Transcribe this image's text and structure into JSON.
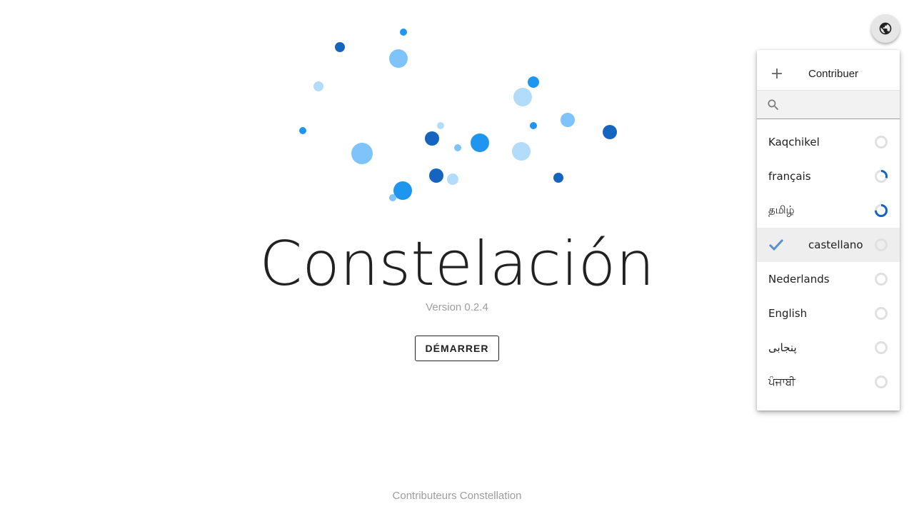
{
  "app": {
    "title": "Constelación",
    "version": "Version 0.2.4",
    "start_label": "DÉMARRER",
    "footer": "Contributeurs Constellation"
  },
  "colors": {
    "dot_dark": "#1565c0",
    "dot_mid": "#1e96f0",
    "dot_light": "#7ec4fa",
    "dot_pale": "#b3dcfb",
    "progress_track": "#e0e0e0",
    "progress_fill": "#1565c0",
    "check": "#5a8fd0"
  },
  "language_button": {
    "icon": "globe-icon"
  },
  "menu": {
    "contribute_label": "Contribuer",
    "contribute_icon": "plus-icon",
    "search_icon": "search-icon",
    "search_value": "",
    "languages": [
      {
        "name": "Kaqchikel",
        "progress": 0.0,
        "selected": false
      },
      {
        "name": "français",
        "progress": 0.3,
        "selected": false
      },
      {
        "name": "தமிழ்",
        "progress": 0.75,
        "selected": false
      },
      {
        "name": "castellano",
        "progress": 0.0,
        "selected": true
      },
      {
        "name": "Nederlands",
        "progress": 0.0,
        "selected": false
      },
      {
        "name": "English",
        "progress": 0.0,
        "selected": false
      },
      {
        "name": "پنجابی",
        "progress": 0.0,
        "selected": false
      },
      {
        "name": "ਪੰਜਾਬੀ",
        "progress": 0.0,
        "selected": false
      }
    ]
  }
}
